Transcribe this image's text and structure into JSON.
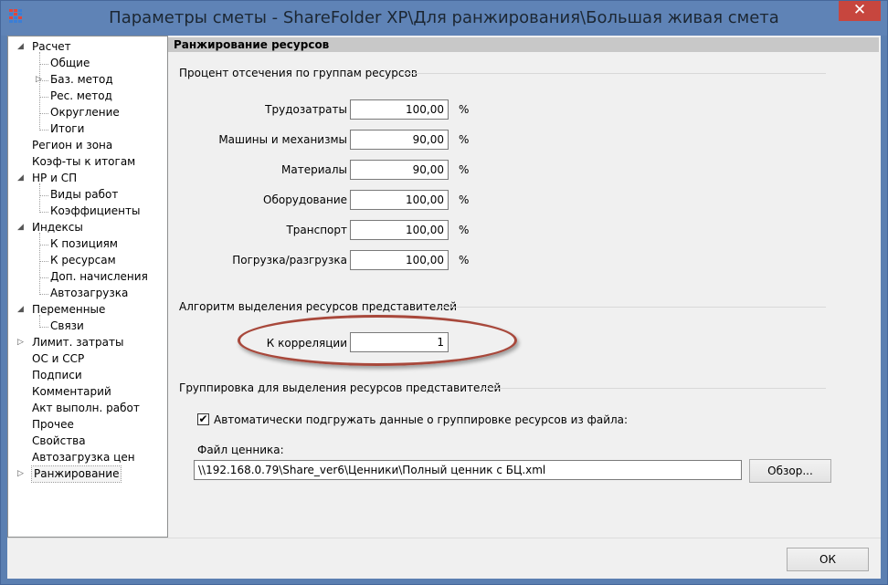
{
  "window": {
    "title": "Параметры сметы - ShareFolder XP\\Для ранжирования\\Большая живая смета",
    "close_glyph": "✕"
  },
  "tree": {
    "items": [
      {
        "label": "Расчет",
        "level": 0,
        "state": "expanded"
      },
      {
        "label": "Общие",
        "level": 1,
        "state": "leaf"
      },
      {
        "label": "Баз. метод",
        "level": 1,
        "state": "collapsed"
      },
      {
        "label": "Рес. метод",
        "level": 1,
        "state": "leaf"
      },
      {
        "label": "Округление",
        "level": 1,
        "state": "leaf"
      },
      {
        "label": "Итоги",
        "level": 1,
        "state": "leaf"
      },
      {
        "label": "Регион и зона",
        "level": 0,
        "state": "leaf"
      },
      {
        "label": "Коэф-ты к итогам",
        "level": 0,
        "state": "leaf"
      },
      {
        "label": "НР и СП",
        "level": 0,
        "state": "expanded"
      },
      {
        "label": "Виды работ",
        "level": 1,
        "state": "leaf"
      },
      {
        "label": "Коэффициенты",
        "level": 1,
        "state": "leaf"
      },
      {
        "label": "Индексы",
        "level": 0,
        "state": "expanded"
      },
      {
        "label": "К позициям",
        "level": 1,
        "state": "leaf"
      },
      {
        "label": "К ресурсам",
        "level": 1,
        "state": "leaf"
      },
      {
        "label": "Доп. начисления",
        "level": 1,
        "state": "leaf"
      },
      {
        "label": "Автозагрузка",
        "level": 1,
        "state": "leaf"
      },
      {
        "label": "Переменные",
        "level": 0,
        "state": "expanded"
      },
      {
        "label": "Связи",
        "level": 1,
        "state": "leaf"
      },
      {
        "label": "Лимит. затраты",
        "level": 0,
        "state": "collapsed"
      },
      {
        "label": "ОС и ССР",
        "level": 0,
        "state": "leaf"
      },
      {
        "label": "Подписи",
        "level": 0,
        "state": "leaf"
      },
      {
        "label": "Комментарий",
        "level": 0,
        "state": "leaf"
      },
      {
        "label": "Акт выполн. работ",
        "level": 0,
        "state": "leaf"
      },
      {
        "label": "Прочее",
        "level": 0,
        "state": "leaf"
      },
      {
        "label": "Свойства",
        "level": 0,
        "state": "leaf"
      },
      {
        "label": "Автозагрузка цен",
        "level": 0,
        "state": "leaf"
      },
      {
        "label": "Ранжирование",
        "level": 0,
        "state": "collapsed",
        "selected": true
      }
    ]
  },
  "panel": {
    "header": "Ранжирование ресурсов",
    "cutoff_group": {
      "title": "Процент отсечения по группам ресурсов",
      "rows": [
        {
          "label": "Трудозатраты",
          "value": "100,00",
          "unit": "%"
        },
        {
          "label": "Машины и механизмы",
          "value": "90,00",
          "unit": "%"
        },
        {
          "label": "Материалы",
          "value": "90,00",
          "unit": "%"
        },
        {
          "label": "Оборудование",
          "value": "100,00",
          "unit": "%"
        },
        {
          "label": "Транспорт",
          "value": "100,00",
          "unit": "%"
        },
        {
          "label": "Погрузка/разгрузка",
          "value": "100,00",
          "unit": "%"
        }
      ]
    },
    "algorithm_group": {
      "title": "Алгоритм выделения ресурсов представителей",
      "correlation_label": "К корреляции",
      "correlation_value": "1"
    },
    "grouping_group": {
      "title": "Группировка для выделения ресурсов представителей",
      "auto_load_label": "Автоматически подгружать данные о группировке ресурсов из файла:",
      "auto_load_checked": true,
      "file_label": "Файл ценника:",
      "file_path": "\\\\192.168.0.79\\Share_ver6\\Ценники\\Полный ценник с БЦ.xml",
      "browse_label": "Обзор..."
    }
  },
  "footer": {
    "ok_label": "ОК"
  }
}
